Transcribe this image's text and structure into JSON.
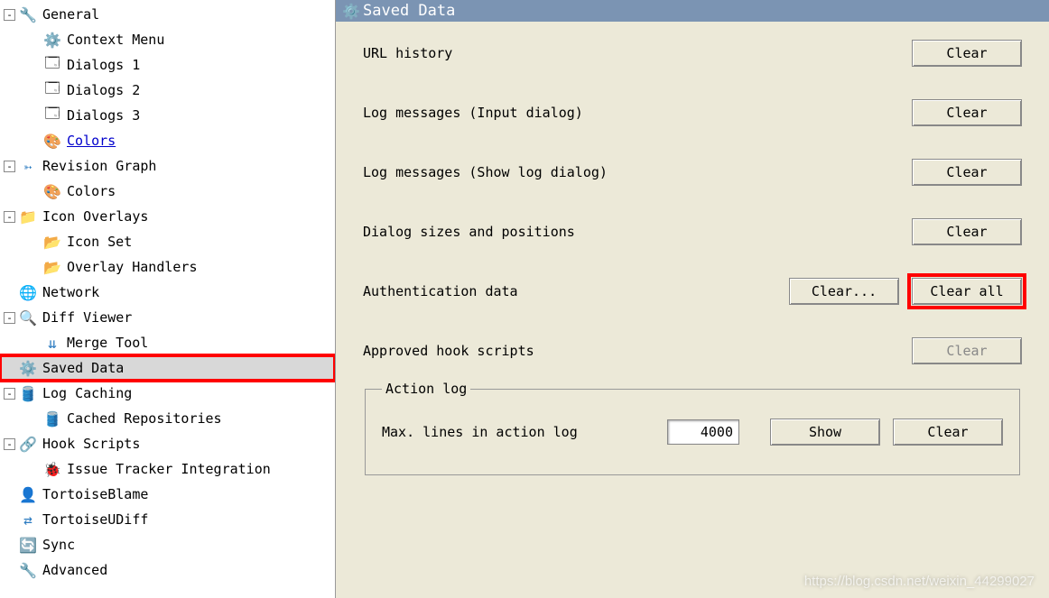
{
  "tree": {
    "general": {
      "label": "General",
      "children": {
        "context_menu": "Context Menu",
        "dialogs1": "Dialogs 1",
        "dialogs2": "Dialogs 2",
        "dialogs3": "Dialogs 3",
        "colors": "Colors"
      }
    },
    "revision_graph": {
      "label": "Revision Graph",
      "children": {
        "colors": "Colors"
      }
    },
    "icon_overlays": {
      "label": "Icon Overlays",
      "children": {
        "icon_set": "Icon Set",
        "overlay_handlers": "Overlay Handlers"
      }
    },
    "network": "Network",
    "diff_viewer": {
      "label": "Diff Viewer",
      "children": {
        "merge_tool": "Merge Tool"
      }
    },
    "saved_data": "Saved Data",
    "log_caching": {
      "label": "Log Caching",
      "children": {
        "cached_repos": "Cached Repositories"
      }
    },
    "hook_scripts": {
      "label": "Hook Scripts",
      "children": {
        "issue_tracker": "Issue Tracker Integration"
      }
    },
    "tortoise_blame": "TortoiseBlame",
    "tortoise_udiff": "TortoiseUDiff",
    "sync": "Sync",
    "advanced": "Advanced"
  },
  "panel": {
    "title": "Saved Data",
    "rows": {
      "url_history": {
        "label": "URL history",
        "clear": "Clear"
      },
      "log_input": {
        "label": "Log messages (Input dialog)",
        "clear": "Clear"
      },
      "log_show": {
        "label": "Log messages (Show log dialog)",
        "clear": "Clear"
      },
      "dialog_sizes": {
        "label": "Dialog sizes and positions",
        "clear": "Clear"
      },
      "auth": {
        "label": "Authentication data",
        "clear_one": "Clear...",
        "clear_all": "Clear all"
      },
      "hooks": {
        "label": "Approved hook scripts",
        "clear": "Clear"
      }
    },
    "action_log": {
      "legend": "Action log",
      "label": "Max. lines in action log",
      "value": "4000",
      "show": "Show",
      "clear": "Clear"
    }
  },
  "watermark": "https://blog.csdn.net/weixin_44299027"
}
